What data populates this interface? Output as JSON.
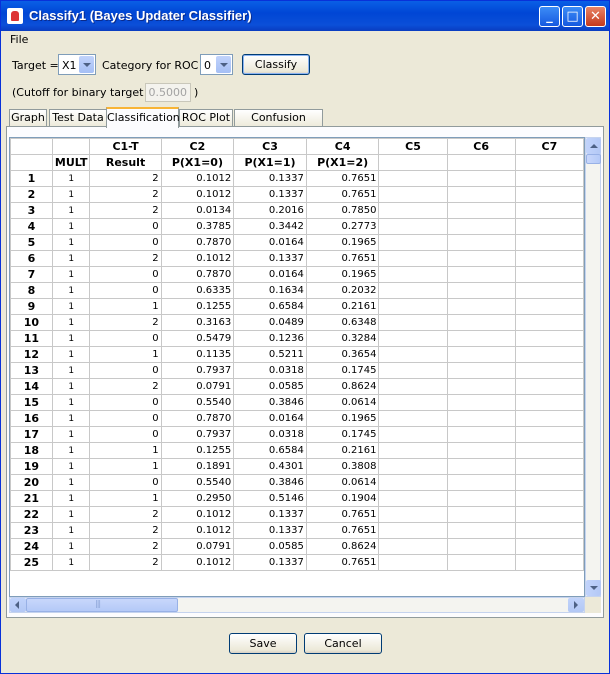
{
  "window": {
    "title": "Classify1 (Bayes Updater Classifier)",
    "minimize_label": "_",
    "maximize_label": "□",
    "close_label": "✕"
  },
  "menu": {
    "file": "File"
  },
  "controls": {
    "target_label": "Target =",
    "target_value": "X1",
    "roc_label": "Category for ROC =",
    "roc_value": "0",
    "classify_button": "Classify",
    "cutoff_prefix": "(Cutoff for binary target =",
    "cutoff_value": "0.5000",
    "cutoff_suffix": ")"
  },
  "tabs": [
    "Graph",
    "Test Data",
    "Classification",
    "ROC Plot",
    "Confusion Matrix"
  ],
  "active_tab": "Classification",
  "grid": {
    "mult_header": "MULT",
    "columns": [
      {
        "id": "C1-T",
        "name": "Result"
      },
      {
        "id": "C2",
        "name": "P(X1=0)"
      },
      {
        "id": "C3",
        "name": "P(X1=1)"
      },
      {
        "id": "C4",
        "name": "P(X1=2)"
      },
      {
        "id": "C5",
        "name": ""
      },
      {
        "id": "C6",
        "name": ""
      },
      {
        "id": "C7",
        "name": ""
      }
    ],
    "rows": [
      {
        "n": "1",
        "mult": "1",
        "result": "2",
        "p0": "0.1012",
        "p1": "0.1337",
        "p2": "0.7651"
      },
      {
        "n": "2",
        "mult": "1",
        "result": "2",
        "p0": "0.1012",
        "p1": "0.1337",
        "p2": "0.7651"
      },
      {
        "n": "3",
        "mult": "1",
        "result": "2",
        "p0": "0.0134",
        "p1": "0.2016",
        "p2": "0.7850"
      },
      {
        "n": "4",
        "mult": "1",
        "result": "0",
        "p0": "0.3785",
        "p1": "0.3442",
        "p2": "0.2773"
      },
      {
        "n": "5",
        "mult": "1",
        "result": "0",
        "p0": "0.7870",
        "p1": "0.0164",
        "p2": "0.1965"
      },
      {
        "n": "6",
        "mult": "1",
        "result": "2",
        "p0": "0.1012",
        "p1": "0.1337",
        "p2": "0.7651"
      },
      {
        "n": "7",
        "mult": "1",
        "result": "0",
        "p0": "0.7870",
        "p1": "0.0164",
        "p2": "0.1965"
      },
      {
        "n": "8",
        "mult": "1",
        "result": "0",
        "p0": "0.6335",
        "p1": "0.1634",
        "p2": "0.2032"
      },
      {
        "n": "9",
        "mult": "1",
        "result": "1",
        "p0": "0.1255",
        "p1": "0.6584",
        "p2": "0.2161"
      },
      {
        "n": "10",
        "mult": "1",
        "result": "2",
        "p0": "0.3163",
        "p1": "0.0489",
        "p2": "0.6348"
      },
      {
        "n": "11",
        "mult": "1",
        "result": "0",
        "p0": "0.5479",
        "p1": "0.1236",
        "p2": "0.3284"
      },
      {
        "n": "12",
        "mult": "1",
        "result": "1",
        "p0": "0.1135",
        "p1": "0.5211",
        "p2": "0.3654"
      },
      {
        "n": "13",
        "mult": "1",
        "result": "0",
        "p0": "0.7937",
        "p1": "0.0318",
        "p2": "0.1745"
      },
      {
        "n": "14",
        "mult": "1",
        "result": "2",
        "p0": "0.0791",
        "p1": "0.0585",
        "p2": "0.8624"
      },
      {
        "n": "15",
        "mult": "1",
        "result": "0",
        "p0": "0.5540",
        "p1": "0.3846",
        "p2": "0.0614"
      },
      {
        "n": "16",
        "mult": "1",
        "result": "0",
        "p0": "0.7870",
        "p1": "0.0164",
        "p2": "0.1965"
      },
      {
        "n": "17",
        "mult": "1",
        "result": "0",
        "p0": "0.7937",
        "p1": "0.0318",
        "p2": "0.1745"
      },
      {
        "n": "18",
        "mult": "1",
        "result": "1",
        "p0": "0.1255",
        "p1": "0.6584",
        "p2": "0.2161"
      },
      {
        "n": "19",
        "mult": "1",
        "result": "1",
        "p0": "0.1891",
        "p1": "0.4301",
        "p2": "0.3808"
      },
      {
        "n": "20",
        "mult": "1",
        "result": "0",
        "p0": "0.5540",
        "p1": "0.3846",
        "p2": "0.0614"
      },
      {
        "n": "21",
        "mult": "1",
        "result": "1",
        "p0": "0.2950",
        "p1": "0.5146",
        "p2": "0.1904"
      },
      {
        "n": "22",
        "mult": "1",
        "result": "2",
        "p0": "0.1012",
        "p1": "0.1337",
        "p2": "0.7651"
      },
      {
        "n": "23",
        "mult": "1",
        "result": "2",
        "p0": "0.1012",
        "p1": "0.1337",
        "p2": "0.7651"
      },
      {
        "n": "24",
        "mult": "1",
        "result": "2",
        "p0": "0.0791",
        "p1": "0.0585",
        "p2": "0.8624"
      },
      {
        "n": "25",
        "mult": "1",
        "result": "2",
        "p0": "0.1012",
        "p1": "0.1337",
        "p2": "0.7651"
      }
    ]
  },
  "footer": {
    "save": "Save",
    "cancel": "Cancel"
  },
  "colors": {
    "title_bar": "#0a5fe6",
    "window_bg": "#ece9d8",
    "active_tab_accent": "#f8b435"
  }
}
